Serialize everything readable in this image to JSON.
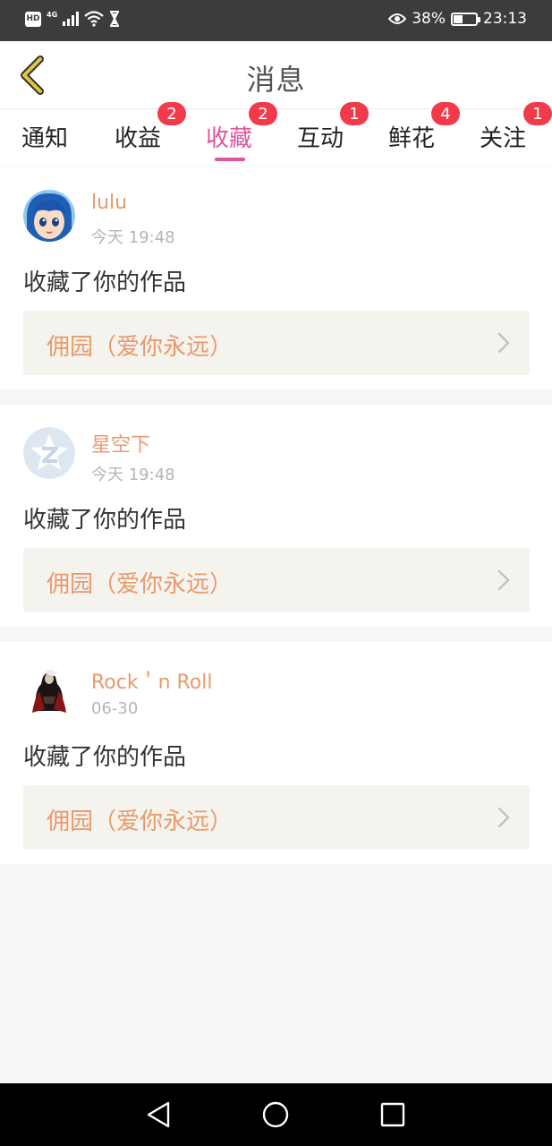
{
  "status_bar": {
    "network_badge": "HD",
    "network_type": "4G",
    "battery_percent": "38%",
    "time": "23:13"
  },
  "header": {
    "title": "消息",
    "back_icon": "chevron-left-icon"
  },
  "tabs": [
    {
      "label": "通知",
      "badge": null,
      "active": false
    },
    {
      "label": "收益",
      "badge": "2",
      "active": false
    },
    {
      "label": "收藏",
      "badge": "2",
      "active": true
    },
    {
      "label": "互动",
      "badge": "1",
      "active": false
    },
    {
      "label": "鲜花",
      "badge": "4",
      "active": false
    },
    {
      "label": "关注",
      "badge": "1",
      "active": false
    }
  ],
  "messages": [
    {
      "username": "lulu",
      "time": "今天 19:48",
      "action": "收藏了你的作品",
      "work_title": "佣园（爱你永远）"
    },
    {
      "username": "星空下",
      "time": "今天 19:48",
      "action": "收藏了你的作品",
      "work_title": "佣园（爱你永远）"
    },
    {
      "username": "Rock＇n Roll",
      "time": "06-30",
      "action": "收藏了你的作品",
      "work_title": "佣园（爱你永远）"
    }
  ],
  "colors": {
    "accent": "#e0559a",
    "username": "#e89a6c",
    "badge": "#f23b4a",
    "back_icon": "#e3c63a"
  }
}
